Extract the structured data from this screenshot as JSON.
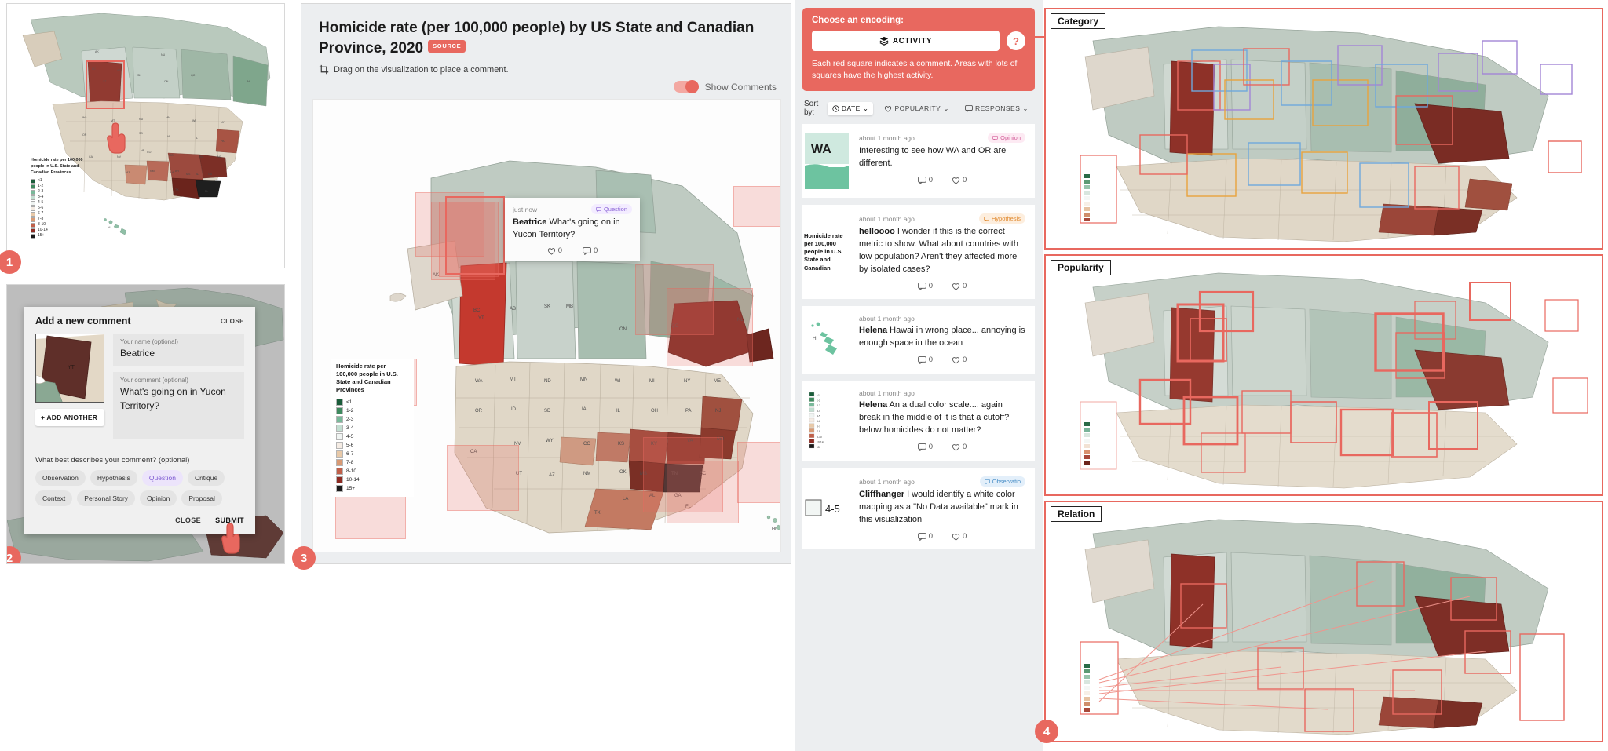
{
  "figure": {
    "panel_numbers": [
      "1",
      "2",
      "3",
      "4"
    ]
  },
  "viz": {
    "title": "Homicide rate (per 100,000 people) by US State and Canadian Province, 2020",
    "source_badge": "SOURCE",
    "hint": "Drag on the visualization to place a comment.",
    "show_comments_label": "Show Comments",
    "crop_icon": "crop-icon"
  },
  "legend": {
    "title": "Homicide rate per 100,000 people in U.S. State and Canadian Provinces",
    "bins": [
      {
        "label": "<1",
        "color": "#1a5c3a"
      },
      {
        "label": "1-2",
        "color": "#3f8a5f"
      },
      {
        "label": "2-3",
        "color": "#79b99a"
      },
      {
        "label": "3-4",
        "color": "#c3ded1"
      },
      {
        "label": "4-5",
        "color": "#f0f4f2"
      },
      {
        "label": "5-6",
        "color": "#f5ece4"
      },
      {
        "label": "6-7",
        "color": "#e8c9a8"
      },
      {
        "label": "7-8",
        "color": "#d99a74"
      },
      {
        "label": "8-10",
        "color": "#c0604a"
      },
      {
        "label": "10-14",
        "color": "#8e2b22"
      },
      {
        "label": "15+",
        "color": "#1a1a1a"
      }
    ]
  },
  "tooltip": {
    "time": "just now",
    "tag": "Question",
    "author": "Beatrice",
    "text": "What's going on in Yucon Territory?",
    "likes": "0",
    "replies": "0"
  },
  "form": {
    "title": "Add a new comment",
    "close_top": "CLOSE",
    "name_label": "Your name (optional)",
    "name_value": "Beatrice",
    "comment_label": "Your comment (optional)",
    "comment_value": "What's going on in Yucon Territory?",
    "add_another": "+ ADD ANOTHER",
    "thumb_label": "YT",
    "describe_question": "What best describes your comment? (optional)",
    "tags": [
      "Observation",
      "Hypothesis",
      "Question",
      "Critique",
      "Context",
      "Personal Story",
      "Opinion",
      "Proposal"
    ],
    "selected_tag": "Question",
    "close": "CLOSE",
    "submit": "SUBMIT"
  },
  "encoding": {
    "choose_label": "Choose an encoding:",
    "selected": "ACTIVITY",
    "layers_icon": "layers-icon",
    "help": "?",
    "description": "Each red square indicates a comment. Areas with lots of squares have the highest activity."
  },
  "sort": {
    "label": "Sort by:",
    "options": [
      {
        "label": "DATE",
        "icon": "clock-icon",
        "active": true
      },
      {
        "label": "POPULARITY",
        "icon": "heart-icon",
        "active": false
      },
      {
        "label": "RESPONSES",
        "icon": "comment-icon",
        "active": false
      }
    ]
  },
  "comments": [
    {
      "time": "about 1 month ago",
      "tag": "Opinion",
      "tag_class": "tag-opinion",
      "author": "",
      "text": "Interesting to see how WA and OR are different.",
      "replies": "0",
      "likes": "0",
      "thumb_label": "WA",
      "thumb_kind": "state"
    },
    {
      "time": "about 1 month ago",
      "tag": "Hypothesis",
      "tag_class": "tag-hypothesis",
      "author": "helloooo",
      "text": "I wonder if this is the correct metric to show. What about countries with low population? Aren't they affected more by isolated cases?",
      "replies": "0",
      "likes": "0",
      "thumb_label": "Homicide rate per 100,000 people in U.S. State and Canadian",
      "thumb_kind": "legend-text"
    },
    {
      "time": "about 1 month ago",
      "tag": "",
      "tag_class": "",
      "author": "Helena",
      "text": "Hawai in wrong place... annoying is enough space in the ocean",
      "replies": "0",
      "likes": "0",
      "thumb_label": "HI",
      "thumb_kind": "hawaii"
    },
    {
      "time": "about 1 month ago",
      "tag": "",
      "tag_class": "",
      "author": "Helena",
      "text": "An a dual color scale.... again break in the middle of it is that a cutoff? below homicides do not matter?",
      "replies": "0",
      "likes": "0",
      "thumb_label": "",
      "thumb_kind": "legend-swatches"
    },
    {
      "time": "about 1 month ago",
      "tag": "Observatio",
      "tag_class": "tag-observation",
      "author": "Cliffhanger",
      "text": "I would identify a white color mapping as a \"No Data available\" mark in this visualization",
      "replies": "0",
      "likes": "0",
      "thumb_label": "4-5",
      "thumb_kind": "swatch-label"
    }
  ],
  "enc_panels": [
    {
      "caption": "Category"
    },
    {
      "caption": "Popularity"
    },
    {
      "caption": "Relation"
    }
  ],
  "colors": {
    "accent": "#e8685f",
    "panel_bg": "#eceef0",
    "card_bg": "#ffffff"
  }
}
